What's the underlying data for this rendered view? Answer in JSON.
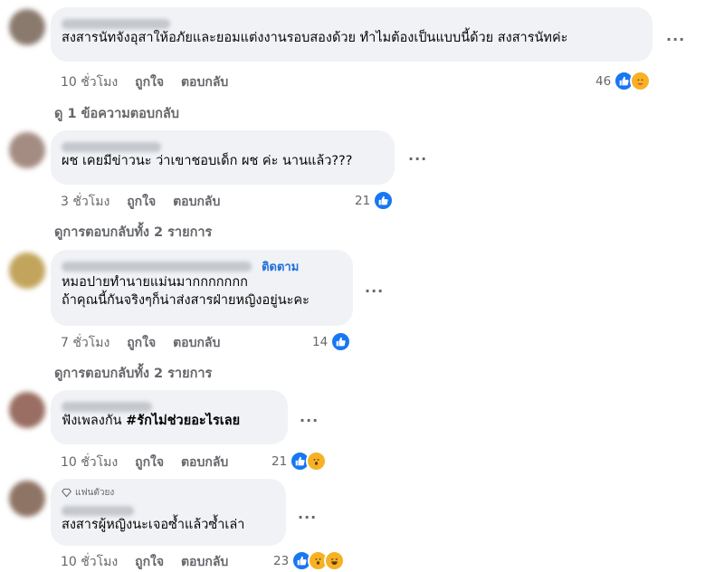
{
  "action_labels": {
    "like": "ถูกใจ",
    "reply": "ตอบกลับ"
  },
  "comments": [
    {
      "text_lines": [
        "สงสารนัทจังอุสาให้อภัยและยอมแต่งงานรอบสองด้วย ทำไมต้องเป็นแบบนี้ด้วย สงสารนัทค่ะ"
      ],
      "time": "10 ชั่วโมง",
      "reaction_count": "46",
      "reactions": [
        "like-icon",
        "care-icon"
      ],
      "replies_label": "ดู 1 ข้อความตอบกลับ"
    },
    {
      "text_lines": [
        "ผช เคยมีข่าวนะ ว่าเขาชอบเด็ก ผช ค่ะ นานแล้ว???"
      ],
      "time": "3 ชั่วโมง",
      "reaction_count": "21",
      "reactions": [
        "like-icon"
      ],
      "replies_label": "ดูการตอบกลับทั้ง 2 รายการ"
    },
    {
      "follow_label": "ติดตาม",
      "text_lines": [
        "หมอปายทำนายแม่นมากกกกกกก",
        "ถ้าคุณนี้กันจริงๆก็น่าส่งสารฝ่ายหญิงอยู่นะคะ"
      ],
      "time": "7 ชั่วโมง",
      "reaction_count": "14",
      "reactions": [
        "like-icon"
      ],
      "replies_label": "ดูการตอบกลับทั้ง 2 รายการ"
    },
    {
      "text_prefix": "ฟังเพลงกัน ",
      "text_bold": "#รักไม่ช่วยอะไรเลย",
      "time": "10 ชั่วโมง",
      "reaction_count": "21",
      "reactions": [
        "like-icon",
        "wow-icon"
      ]
    },
    {
      "badge": "แฟนตัวยง",
      "text_lines": [
        "สงสารผู้หญิงนะเจอซ้ำแล้วซ้ำเล่า"
      ],
      "time": "10 ชั่วโมง",
      "reaction_count": "23",
      "reactions": [
        "like-icon",
        "wow-icon",
        "haha-icon"
      ]
    }
  ],
  "colors": {
    "bubble": "#f0f2f5",
    "link": "#216fdb",
    "secondary_text": "#65676b",
    "like_blue": "#1877f2"
  }
}
